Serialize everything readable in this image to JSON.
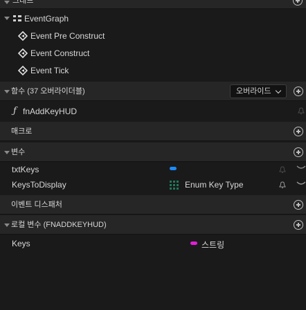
{
  "top": {
    "cut_label": "그래프"
  },
  "graphs": {
    "title": "EventGraph",
    "events": [
      {
        "label": "Event Pre Construct"
      },
      {
        "label": "Event Construct"
      },
      {
        "label": "Event Tick"
      }
    ]
  },
  "functions": {
    "title": "함수 (37 오버라이더블)",
    "override_label": "오버라이드",
    "items": [
      {
        "label": "fnAddKeyHUD"
      }
    ]
  },
  "macros": {
    "title": "매크로"
  },
  "variables": {
    "title": "변수",
    "items": [
      {
        "name": "txtKeys",
        "type_label": "",
        "type_color": "#1a8cff"
      },
      {
        "name": "KeysToDisplay",
        "type_label": "Enum Key Type",
        "type_color": "#1f6b4f"
      }
    ]
  },
  "dispatchers": {
    "title": "이벤트 디스패처"
  },
  "local_vars": {
    "title": "로컬 변수 (FNADDKEYHUD)",
    "items": [
      {
        "name": "Keys",
        "type_label": "스트링",
        "type_color": "#e11fd5"
      }
    ]
  },
  "colors": {
    "accent_blue": "#1a8cff",
    "string_pink": "#e11fd5",
    "section_bg": "#262626"
  }
}
